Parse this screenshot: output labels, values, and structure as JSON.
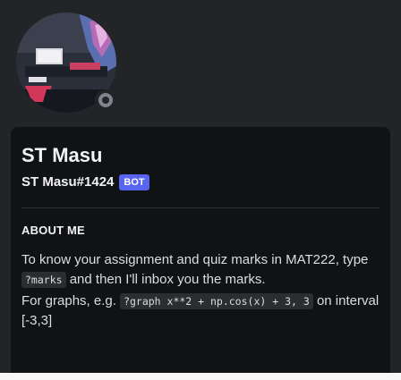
{
  "profile": {
    "display_name": "ST Masu",
    "username": "ST Masu#1424",
    "bot_badge": "BOT",
    "status": "offline"
  },
  "about": {
    "title": "ABOUT ME",
    "line1_pre": "To know your assignment and quiz marks in MAT222, type ",
    "cmd_marks": "?marks",
    "line1_post": " and then I'll inbox you the marks.",
    "line2_pre": "For graphs, e.g. ",
    "cmd_graph": "?graph x**2 + np.cos(x) + 3, 3",
    "line2_post": " on interval [-3,3]"
  },
  "colors": {
    "background": "#232428",
    "card": "#111214",
    "bot_badge": "#5865f2",
    "status_offline": "#80848e"
  }
}
